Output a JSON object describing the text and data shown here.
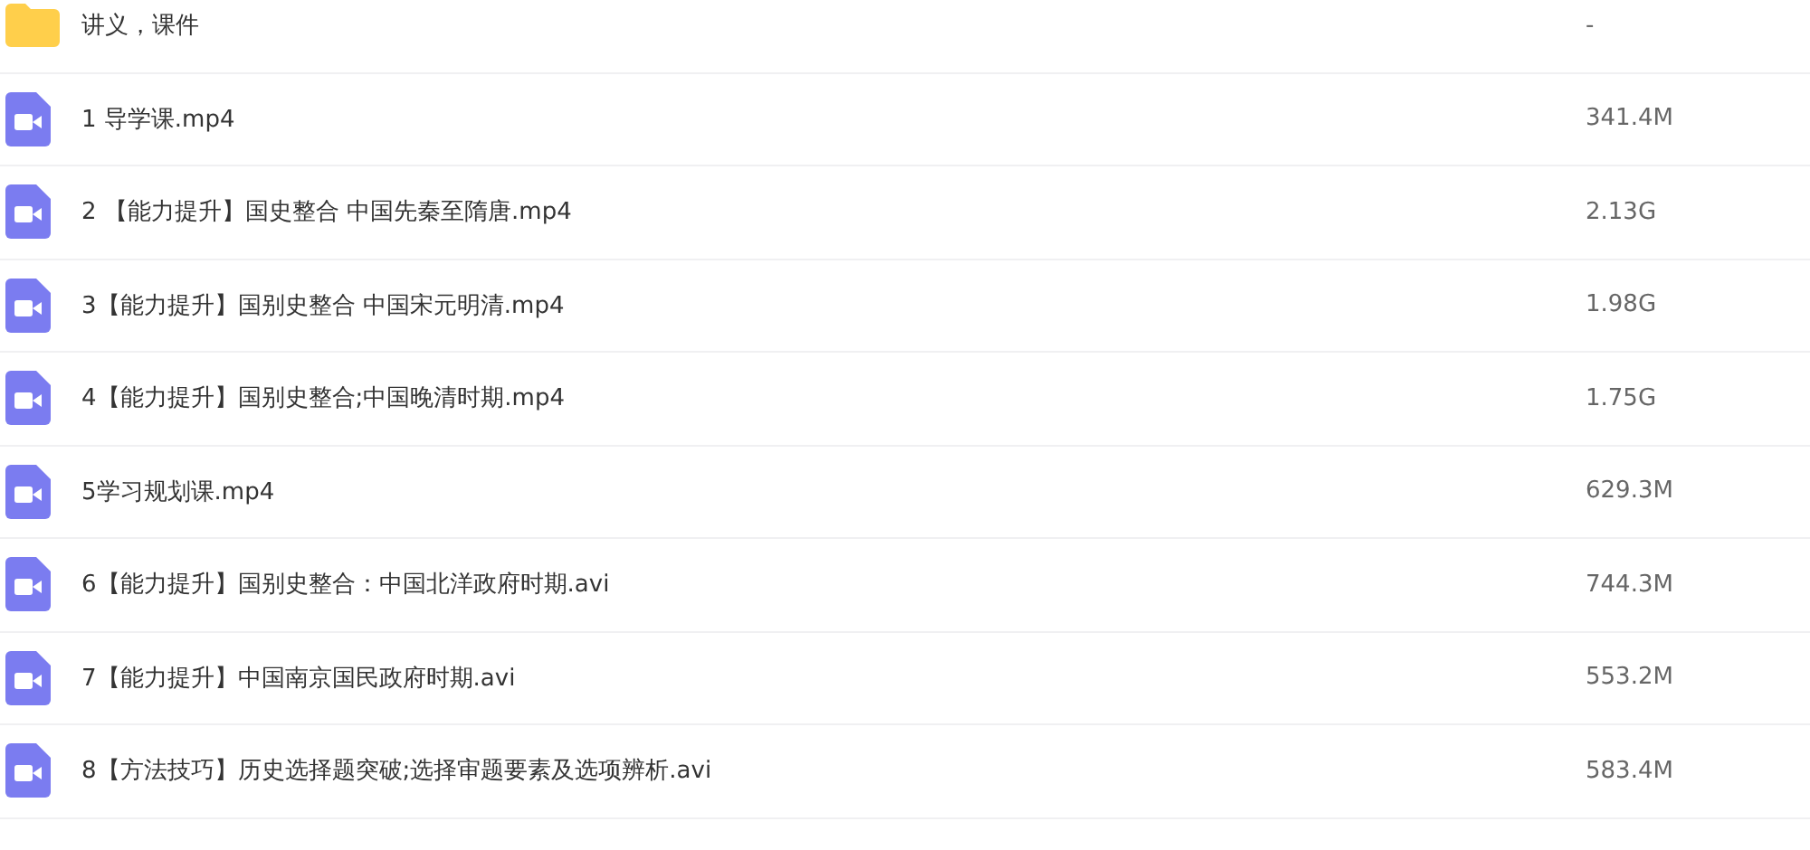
{
  "files": [
    {
      "kind": "folder",
      "name": "讲义，课件",
      "size": "-"
    },
    {
      "kind": "video",
      "name": "1 导学课.mp4",
      "size": "341.4M"
    },
    {
      "kind": "video",
      "name": "2 【能力提升】国史整合 中国先秦至隋唐.mp4",
      "size": "2.13G"
    },
    {
      "kind": "video",
      "name": "3【能力提升】国别史整合 中国宋元明清.mp4",
      "size": "1.98G"
    },
    {
      "kind": "video",
      "name": "4【能力提升】国别史整合;中国晚清时期.mp4",
      "size": "1.75G"
    },
    {
      "kind": "video",
      "name": "5学习规划课.mp4",
      "size": "629.3M"
    },
    {
      "kind": "video",
      "name": "6【能力提升】国别史整合：中国北洋政府时期.avi",
      "size": "744.3M"
    },
    {
      "kind": "video",
      "name": "7【能力提升】中国南京国民政府时期.avi",
      "size": "553.2M"
    },
    {
      "kind": "video",
      "name": "8【方法技巧】历史选择题突破;选择审题要素及选项辨析.avi",
      "size": "583.4M"
    }
  ]
}
